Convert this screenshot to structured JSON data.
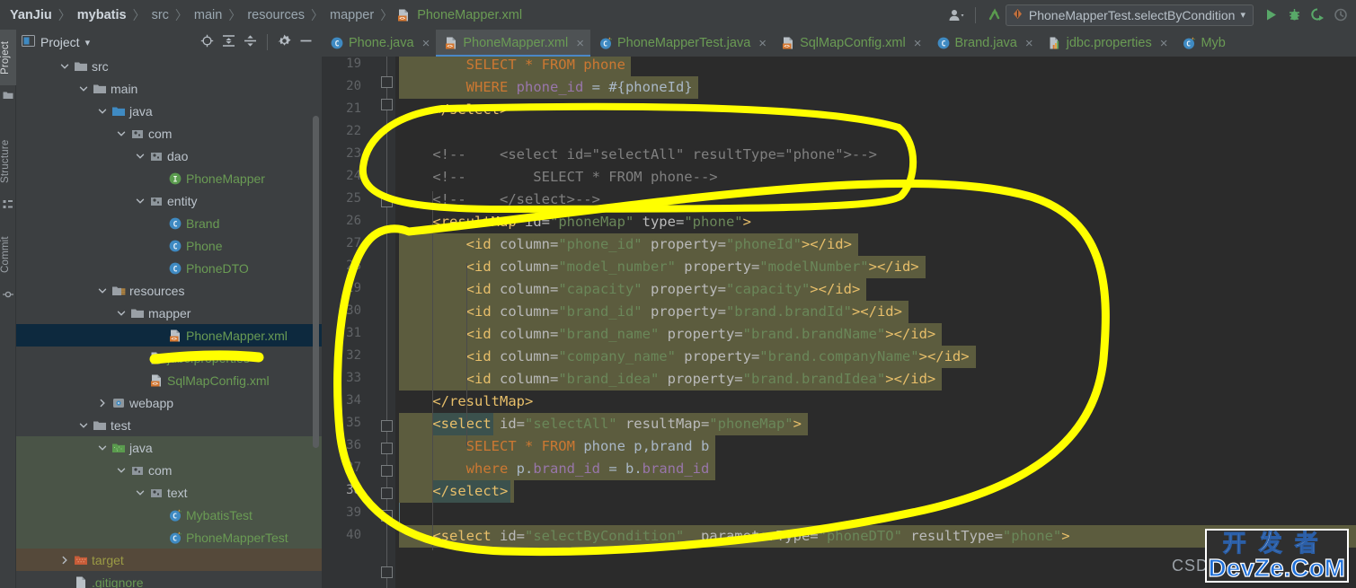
{
  "window": {
    "title": "PhoneMapper.xml"
  },
  "breadcrumb": {
    "separator": "〉",
    "items": [
      {
        "label": "YanJiu",
        "style": "bold"
      },
      {
        "label": "mybatis",
        "style": "bold"
      },
      {
        "label": "src",
        "style": "plain"
      },
      {
        "label": "main",
        "style": "plain"
      },
      {
        "label": "resources",
        "style": "plain"
      },
      {
        "label": "mapper",
        "style": "plain"
      },
      {
        "label": "PhoneMapper.xml",
        "style": "file",
        "icon": "xml-file-icon"
      }
    ]
  },
  "toolbar": {
    "account_icon": "user-avatar-icon",
    "account_caret": "▾",
    "updates_icon": "vcs-update-icon",
    "run_config": {
      "icon": "run-config-icon",
      "label": "PhoneMapperTest.selectByCondition",
      "caret": "▾"
    },
    "run_icon": "run-play-icon",
    "debug_icon": "debug-bug-icon",
    "run_with_coverage_icon": "run-coverage-icon",
    "profiler_icon": "profiler-icon"
  },
  "left_strip": {
    "tabs": [
      {
        "label": "Project",
        "icon": "project-folder-icon",
        "active": true
      },
      {
        "label": "Structure",
        "icon": "structure-icon",
        "active": false
      },
      {
        "label": "Commit",
        "icon": "commit-icon",
        "active": false
      }
    ]
  },
  "project_panel": {
    "title": "Project",
    "title_caret": "▾",
    "icons": [
      "locate-target-icon",
      "expand-all-icon",
      "collapse-all-icon",
      "settings-gear-icon",
      "hide-minimize-icon"
    ],
    "tree": [
      {
        "label": "src",
        "indent": 2,
        "arrow": "down",
        "icon": "folder-icon",
        "color": "plain"
      },
      {
        "label": "main",
        "indent": 3,
        "arrow": "down",
        "icon": "folder-icon",
        "color": "plain"
      },
      {
        "label": "java",
        "indent": 4,
        "arrow": "down",
        "icon": "source-folder-icon",
        "color": "plain"
      },
      {
        "label": "com",
        "indent": 5,
        "arrow": "down",
        "icon": "package-icon",
        "color": "plain"
      },
      {
        "label": "dao",
        "indent": 6,
        "arrow": "down",
        "icon": "package-icon",
        "color": "plain"
      },
      {
        "label": "PhoneMapper",
        "indent": 7,
        "arrow": "none",
        "icon": "interface-icon",
        "color": "green"
      },
      {
        "label": "entity",
        "indent": 6,
        "arrow": "down",
        "icon": "package-icon",
        "color": "plain"
      },
      {
        "label": "Brand",
        "indent": 7,
        "arrow": "none",
        "icon": "class-icon",
        "color": "green"
      },
      {
        "label": "Phone",
        "indent": 7,
        "arrow": "none",
        "icon": "class-icon",
        "color": "green"
      },
      {
        "label": "PhoneDTO",
        "indent": 7,
        "arrow": "none",
        "icon": "class-icon",
        "color": "green"
      },
      {
        "label": "resources",
        "indent": 4,
        "arrow": "down",
        "icon": "resources-folder-icon",
        "color": "plain"
      },
      {
        "label": "mapper",
        "indent": 5,
        "arrow": "down",
        "icon": "folder-icon",
        "color": "plain"
      },
      {
        "label": "PhoneMapper.xml",
        "indent": 7,
        "arrow": "none",
        "icon": "xml-file-icon",
        "color": "green",
        "selected": true
      },
      {
        "label": "jdbc.properties",
        "indent": 6,
        "arrow": "none",
        "icon": "properties-file-icon",
        "color": "green"
      },
      {
        "label": "SqlMapConfig.xml",
        "indent": 6,
        "arrow": "none",
        "icon": "xml-file-icon",
        "color": "green"
      },
      {
        "label": "webapp",
        "indent": 4,
        "arrow": "right",
        "icon": "webapp-folder-icon",
        "color": "plain"
      },
      {
        "label": "test",
        "indent": 3,
        "arrow": "down",
        "icon": "folder-icon",
        "color": "plain"
      },
      {
        "label": "java",
        "indent": 4,
        "arrow": "down",
        "icon": "test-source-folder-icon",
        "color": "plain",
        "row": "testsrc"
      },
      {
        "label": "com",
        "indent": 5,
        "arrow": "down",
        "icon": "package-icon",
        "color": "plain",
        "row": "testsrc"
      },
      {
        "label": "text",
        "indent": 6,
        "arrow": "down",
        "icon": "package-icon",
        "color": "plain",
        "row": "testsrc"
      },
      {
        "label": "MybatisTest",
        "indent": 7,
        "arrow": "none",
        "icon": "test-class-icon",
        "color": "green",
        "row": "testsrc"
      },
      {
        "label": "PhoneMapperTest",
        "indent": 7,
        "arrow": "none",
        "icon": "test-class-icon",
        "color": "green",
        "row": "testsrc"
      },
      {
        "label": "target",
        "indent": 2,
        "arrow": "right",
        "icon": "excluded-folder-icon",
        "color": "olive",
        "row": "target"
      },
      {
        "label": ".gitignore",
        "indent": 2,
        "arrow": "none",
        "icon": "gitignore-file-icon",
        "color": "green"
      }
    ]
  },
  "editor_tabs": [
    {
      "label": "Phone.java",
      "icon": "java-class-icon",
      "active": false,
      "close": "×"
    },
    {
      "label": "PhoneMapper.xml",
      "icon": "xml-file-icon",
      "active": true,
      "close": "×"
    },
    {
      "label": "PhoneMapperTest.java",
      "icon": "test-class-icon",
      "active": false,
      "close": "×"
    },
    {
      "label": "SqlMapConfig.xml",
      "icon": "xml-file-icon",
      "active": false,
      "close": "×"
    },
    {
      "label": "Brand.java",
      "icon": "java-class-icon",
      "active": false,
      "close": "×"
    },
    {
      "label": "jdbc.properties",
      "icon": "properties-file-icon",
      "active": false,
      "close": "×"
    },
    {
      "label": "Myb",
      "icon": "test-class-icon",
      "active": false,
      "close": ""
    }
  ],
  "editor": {
    "first_line": 19,
    "current_line": 38,
    "lines": [
      {
        "n": 19,
        "tokens": [
          {
            "t": "        ",
            "c": "t-txt"
          },
          {
            "t": "SELECT * FROM phone",
            "c": "t-kw"
          }
        ],
        "band": "highlight",
        "clip_top": true,
        "sel": true
      },
      {
        "n": 20,
        "tokens": [
          {
            "t": "        ",
            "c": "t-txt"
          },
          {
            "t": "WHERE ",
            "c": "t-kw"
          },
          {
            "t": "phone_id",
            "c": "t-ident"
          },
          {
            "t": " = ",
            "c": "t-txt"
          },
          {
            "t": "#{phoneId}",
            "c": "t-txt"
          }
        ],
        "band": "highlight"
      },
      {
        "n": 21,
        "tokens": [
          {
            "t": "    ",
            "c": "t-txt"
          },
          {
            "t": "</select>",
            "c": "t-tag"
          }
        ],
        "band": "none"
      },
      {
        "n": 22,
        "tokens": [],
        "band": "none"
      },
      {
        "n": 23,
        "tokens": [
          {
            "t": "    ",
            "c": "t-txt"
          },
          {
            "t": "<!--    <select id=\"selectAll\" resultType=\"phone\">-->",
            "c": "t-cmt"
          }
        ],
        "band": "none"
      },
      {
        "n": 24,
        "tokens": [
          {
            "t": "    ",
            "c": "t-txt"
          },
          {
            "t": "<!--        SELECT * FROM phone-->",
            "c": "t-cmt"
          }
        ],
        "band": "none"
      },
      {
        "n": 25,
        "tokens": [
          {
            "t": "    ",
            "c": "t-txt"
          },
          {
            "t": "<!--    </select>-->",
            "c": "t-cmt"
          }
        ],
        "band": "none"
      },
      {
        "n": 26,
        "tokens": [
          {
            "t": "    ",
            "c": "t-txt"
          },
          {
            "t": "<resultMap ",
            "c": "t-tag"
          },
          {
            "t": "id=",
            "c": "t-attr"
          },
          {
            "t": "\"phoneMap\"",
            "c": "t-val"
          },
          {
            "t": " type=",
            "c": "t-attr"
          },
          {
            "t": "\"phone\"",
            "c": "t-val"
          },
          {
            "t": ">",
            "c": "t-tag"
          }
        ],
        "band": "none"
      },
      {
        "n": 27,
        "tokens": [
          {
            "t": "        ",
            "c": "t-txt"
          },
          {
            "t": "<id ",
            "c": "t-tag"
          },
          {
            "t": "column=",
            "c": "t-attr"
          },
          {
            "t": "\"phone_id\"",
            "c": "t-val"
          },
          {
            "t": " property=",
            "c": "t-attr"
          },
          {
            "t": "\"phoneId\"",
            "c": "t-val"
          },
          {
            "t": "></id>",
            "c": "t-tag"
          }
        ],
        "band": "highlight"
      },
      {
        "n": 28,
        "tokens": [
          {
            "t": "        ",
            "c": "t-txt"
          },
          {
            "t": "<id ",
            "c": "t-tag"
          },
          {
            "t": "column=",
            "c": "t-attr"
          },
          {
            "t": "\"model_number\"",
            "c": "t-val"
          },
          {
            "t": " property=",
            "c": "t-attr"
          },
          {
            "t": "\"modelNumber\"",
            "c": "t-val"
          },
          {
            "t": "></id>",
            "c": "t-tag"
          }
        ],
        "band": "highlight"
      },
      {
        "n": 29,
        "tokens": [
          {
            "t": "        ",
            "c": "t-txt"
          },
          {
            "t": "<id ",
            "c": "t-tag"
          },
          {
            "t": "column=",
            "c": "t-attr"
          },
          {
            "t": "\"capacity\"",
            "c": "t-val"
          },
          {
            "t": " property=",
            "c": "t-attr"
          },
          {
            "t": "\"capacity\"",
            "c": "t-val"
          },
          {
            "t": "></id>",
            "c": "t-tag"
          }
        ],
        "band": "highlight"
      },
      {
        "n": 30,
        "tokens": [
          {
            "t": "        ",
            "c": "t-txt"
          },
          {
            "t": "<id ",
            "c": "t-tag"
          },
          {
            "t": "column=",
            "c": "t-attr"
          },
          {
            "t": "\"brand_id\"",
            "c": "t-val"
          },
          {
            "t": " property=",
            "c": "t-attr"
          },
          {
            "t": "\"brand.brandId\"",
            "c": "t-val"
          },
          {
            "t": "></id>",
            "c": "t-tag"
          }
        ],
        "band": "highlight"
      },
      {
        "n": 31,
        "tokens": [
          {
            "t": "        ",
            "c": "t-txt"
          },
          {
            "t": "<id ",
            "c": "t-tag"
          },
          {
            "t": "column=",
            "c": "t-attr"
          },
          {
            "t": "\"brand_name\"",
            "c": "t-val"
          },
          {
            "t": " property=",
            "c": "t-attr"
          },
          {
            "t": "\"brand.brandName\"",
            "c": "t-val"
          },
          {
            "t": "></id>",
            "c": "t-tag"
          }
        ],
        "band": "highlight"
      },
      {
        "n": 32,
        "tokens": [
          {
            "t": "        ",
            "c": "t-txt"
          },
          {
            "t": "<id ",
            "c": "t-tag"
          },
          {
            "t": "column=",
            "c": "t-attr"
          },
          {
            "t": "\"company_name\"",
            "c": "t-val"
          },
          {
            "t": " property=",
            "c": "t-attr"
          },
          {
            "t": "\"brand.companyName\"",
            "c": "t-val"
          },
          {
            "t": "></id>",
            "c": "t-tag"
          }
        ],
        "band": "highlight"
      },
      {
        "n": 33,
        "tokens": [
          {
            "t": "        ",
            "c": "t-txt"
          },
          {
            "t": "<id ",
            "c": "t-tag"
          },
          {
            "t": "column=",
            "c": "t-attr"
          },
          {
            "t": "\"brand_idea\"",
            "c": "t-val"
          },
          {
            "t": " property=",
            "c": "t-attr"
          },
          {
            "t": "\"brand.brandIdea\"",
            "c": "t-val"
          },
          {
            "t": "></id>",
            "c": "t-tag"
          }
        ],
        "band": "highlight"
      },
      {
        "n": 34,
        "tokens": [
          {
            "t": "    ",
            "c": "t-txt"
          },
          {
            "t": "</resultMap>",
            "c": "t-tag"
          }
        ],
        "band": "none"
      },
      {
        "n": 35,
        "tokens": [
          {
            "t": "    ",
            "c": "t-txt"
          },
          {
            "t": "<select ",
            "c": "t-tag",
            "caret": true
          },
          {
            "t": "id=",
            "c": "t-attr"
          },
          {
            "t": "\"selectAll\"",
            "c": "t-val"
          },
          {
            "t": " resultMap=",
            "c": "t-attr"
          },
          {
            "t": "\"phoneMap\"",
            "c": "t-val"
          },
          {
            "t": ">",
            "c": "t-tag"
          }
        ],
        "band": "highlight"
      },
      {
        "n": 36,
        "tokens": [
          {
            "t": "        ",
            "c": "t-txt"
          },
          {
            "t": "SELECT * FROM ",
            "c": "t-kw"
          },
          {
            "t": "phone p,brand b",
            "c": "t-txt"
          }
        ],
        "band": "highlight"
      },
      {
        "n": 37,
        "tokens": [
          {
            "t": "        ",
            "c": "t-txt"
          },
          {
            "t": "where ",
            "c": "t-kw"
          },
          {
            "t": "p.",
            "c": "t-txt"
          },
          {
            "t": "brand_id",
            "c": "t-ident"
          },
          {
            "t": " = ",
            "c": "t-txt"
          },
          {
            "t": "b.",
            "c": "t-txt"
          },
          {
            "t": "brand_id",
            "c": "t-ident"
          }
        ],
        "band": "highlight"
      },
      {
        "n": 38,
        "tokens": [
          {
            "t": "    ",
            "c": "t-txt"
          },
          {
            "t": "</select>",
            "c": "t-tag",
            "caret": true
          }
        ],
        "band": "highlight",
        "current": true
      },
      {
        "n": 39,
        "tokens": [],
        "band": "none"
      },
      {
        "n": 40,
        "tokens": [
          {
            "t": "    ",
            "c": "t-txt"
          },
          {
            "t": "<select ",
            "c": "t-tag"
          },
          {
            "t": "id=",
            "c": "t-attr"
          },
          {
            "t": "\"selectByCondition\"",
            "c": "t-val"
          },
          {
            "t": "  parameterType=",
            "c": "t-attr"
          },
          {
            "t": "\"phoneDTO\"",
            "c": "t-val"
          },
          {
            "t": " resultType=",
            "c": "t-attr"
          },
          {
            "t": "\"phone\"",
            "c": "t-val"
          },
          {
            "t": ">",
            "c": "t-tag"
          }
        ],
        "band": "highlight-partial"
      }
    ]
  },
  "annotation": {
    "color": "#ffff00",
    "shapes": [
      "ellipse-around-commented-select-block",
      "large-ellipse-around-resultmap-and-select",
      "underline-under-phonemapper-xml-tree-item"
    ]
  },
  "watermark": {
    "csdn": "CSDN",
    "chinese": "开发者",
    "site": "DevZe.CoM"
  },
  "colors": {
    "editor_background": "#2b2b2b",
    "panel_background": "#3c3f41",
    "gutter_background": "#313335",
    "selection_blue": "#214283",
    "tab_underline": "#4a88c7",
    "highlight_band": "#5c5c3e",
    "annotation_yellow": "#ffff00",
    "tree_selected": "#0d293e",
    "test_source_root": "#4a5447",
    "excluded_folder": "#55493a"
  }
}
